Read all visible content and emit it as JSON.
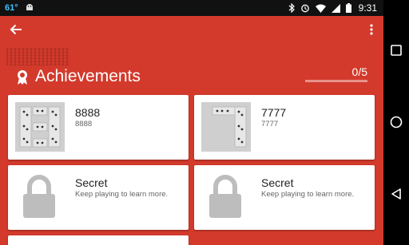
{
  "status_bar": {
    "temperature": "61°",
    "time": "9:31"
  },
  "app_bar": {
    "back_icon": "arrow-back-icon",
    "menu_icon": "more-vert-icon"
  },
  "header": {
    "title": "Achievements",
    "progress_text": "0/5",
    "progress_fraction": 0.0
  },
  "achievements": [
    {
      "name": "8888",
      "description": "8888",
      "icon": "tile-8888-icon",
      "locked": false
    },
    {
      "name": "7777",
      "description": "7777",
      "icon": "tile-7777-icon",
      "locked": false
    },
    {
      "name": "Secret",
      "description": "Keep playing to learn more.",
      "icon": "lock-icon",
      "locked": true
    },
    {
      "name": "Secret",
      "description": "Keep playing to learn more.",
      "icon": "lock-icon",
      "locked": true
    }
  ],
  "nav_bar": {
    "buttons": [
      "recents-square-icon",
      "home-circle-icon",
      "back-triangle-icon"
    ]
  },
  "colors": {
    "primary": "#d33a2c",
    "status_bar": "#111111",
    "temp_accent": "#3fc3ff",
    "card": "#ffffff"
  }
}
